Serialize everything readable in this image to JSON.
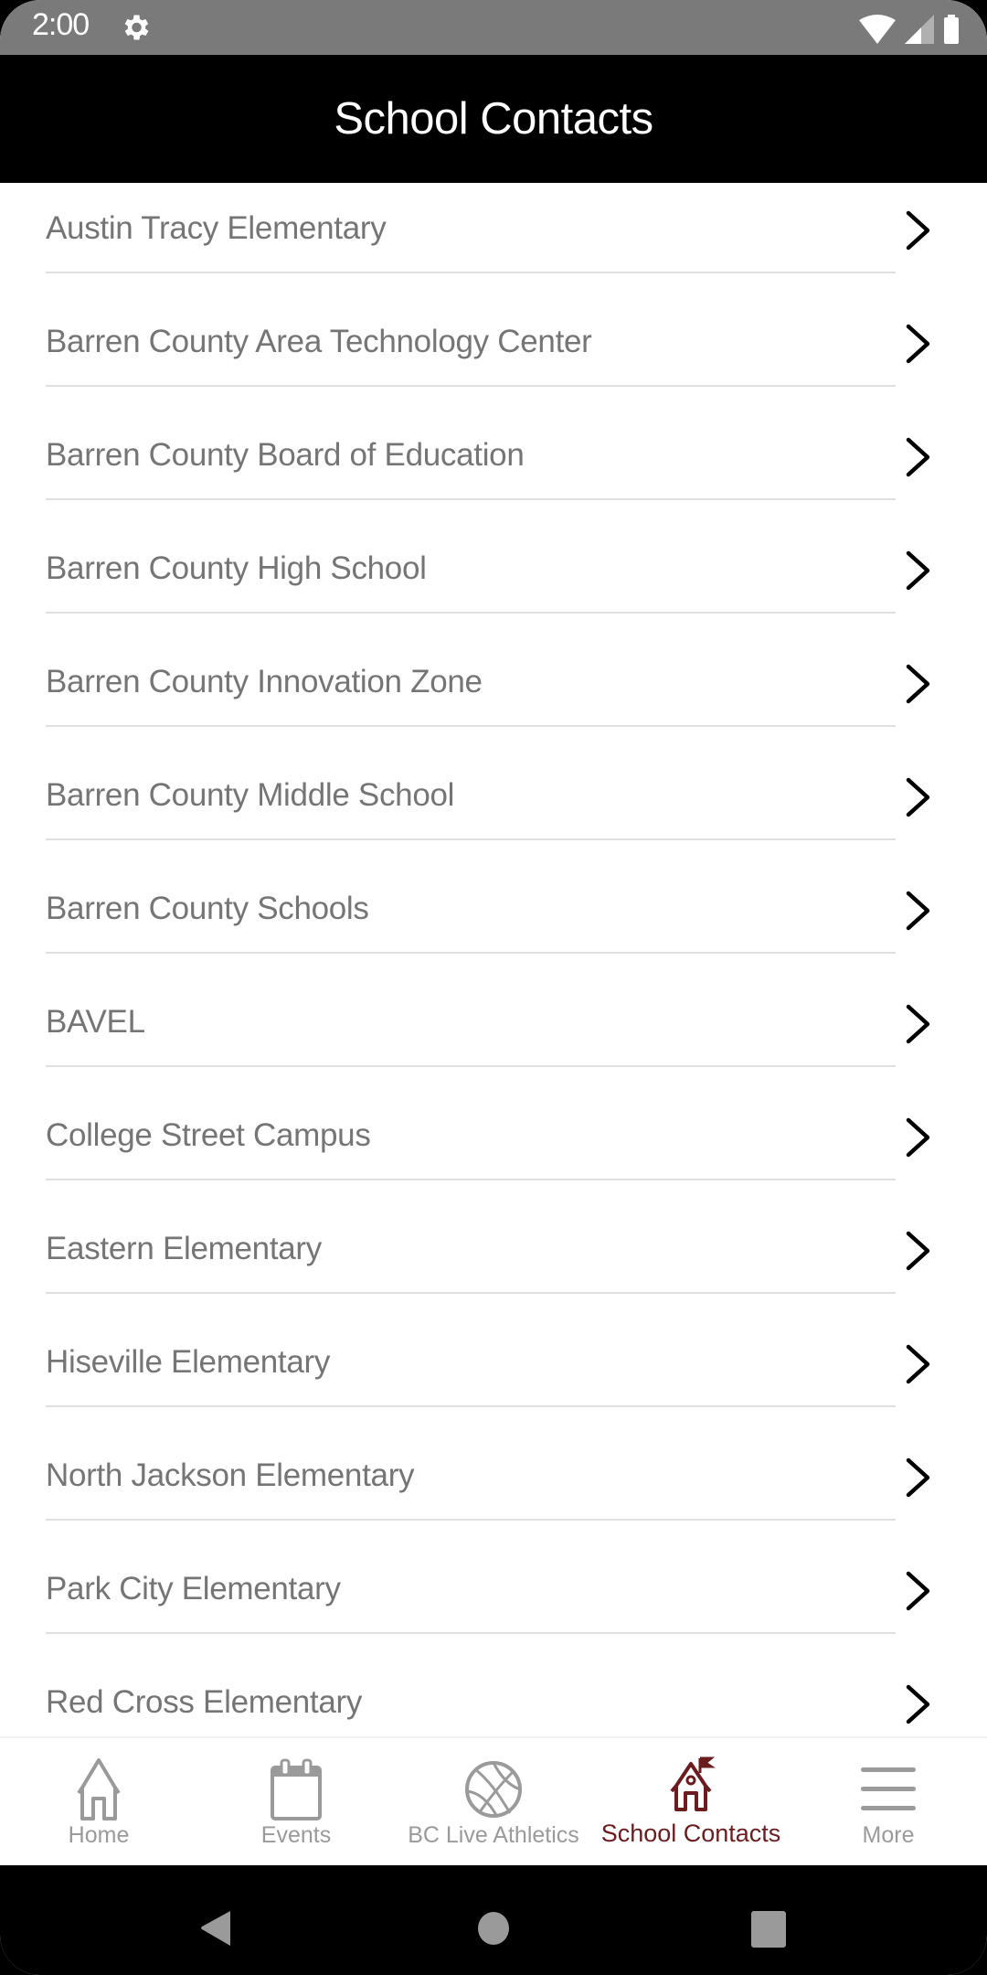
{
  "status_bar": {
    "time": "2:00",
    "icons": [
      "gear-icon",
      "wifi-icon",
      "signal-icon",
      "battery-icon"
    ]
  },
  "app_bar": {
    "title": "School Contacts"
  },
  "contacts": [
    {
      "name": "Austin Tracy Elementary"
    },
    {
      "name": "Barren County Area Technology Center"
    },
    {
      "name": "Barren County Board of Education"
    },
    {
      "name": "Barren County High School"
    },
    {
      "name": "Barren County Innovation Zone"
    },
    {
      "name": "Barren County Middle School"
    },
    {
      "name": "Barren County Schools"
    },
    {
      "name": "BAVEL"
    },
    {
      "name": "College Street Campus"
    },
    {
      "name": "Eastern Elementary"
    },
    {
      "name": "Hiseville Elementary"
    },
    {
      "name": "North Jackson Elementary"
    },
    {
      "name": "Park City Elementary"
    },
    {
      "name": "Red Cross Elementary"
    }
  ],
  "tab_bar": {
    "active_color": "#6b1c1f",
    "inactive_color": "#9a9a9a",
    "tabs": [
      {
        "label": "Home",
        "icon": "home-icon",
        "active": false
      },
      {
        "label": "Events",
        "icon": "calendar-icon",
        "active": false
      },
      {
        "label": "BC Live Athletics",
        "icon": "basketball-icon",
        "active": false
      },
      {
        "label": "School Contacts",
        "icon": "schoolhouse-icon",
        "active": true
      },
      {
        "label": "More",
        "icon": "menu-icon",
        "active": false
      }
    ]
  },
  "nav_bar": {
    "buttons": [
      "back",
      "home",
      "recents"
    ]
  }
}
